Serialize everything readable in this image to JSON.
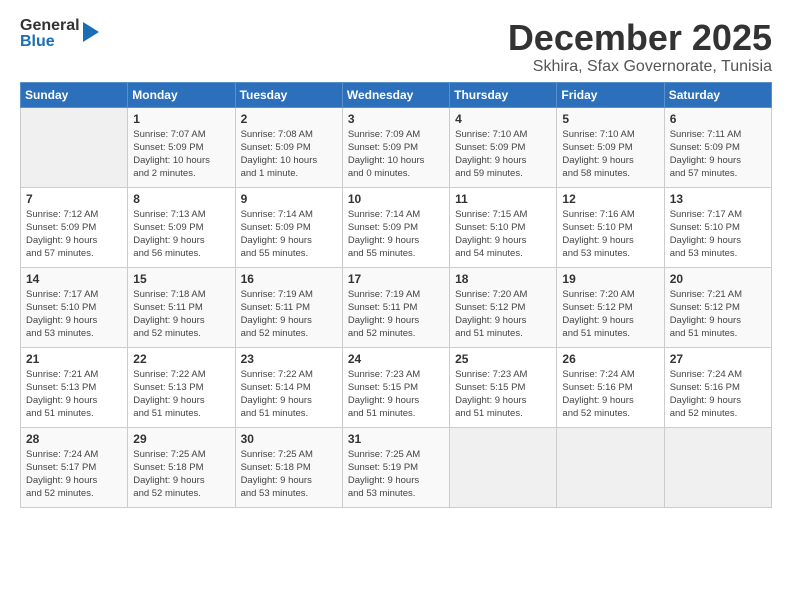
{
  "header": {
    "logo": {
      "general": "General",
      "blue": "Blue"
    },
    "title": "December 2025",
    "location": "Skhira, Sfax Governorate, Tunisia"
  },
  "days_of_week": [
    "Sunday",
    "Monday",
    "Tuesday",
    "Wednesday",
    "Thursday",
    "Friday",
    "Saturday"
  ],
  "weeks": [
    [
      {
        "day": "",
        "info": ""
      },
      {
        "day": "1",
        "info": "Sunrise: 7:07 AM\nSunset: 5:09 PM\nDaylight: 10 hours\nand 2 minutes."
      },
      {
        "day": "2",
        "info": "Sunrise: 7:08 AM\nSunset: 5:09 PM\nDaylight: 10 hours\nand 1 minute."
      },
      {
        "day": "3",
        "info": "Sunrise: 7:09 AM\nSunset: 5:09 PM\nDaylight: 10 hours\nand 0 minutes."
      },
      {
        "day": "4",
        "info": "Sunrise: 7:10 AM\nSunset: 5:09 PM\nDaylight: 9 hours\nand 59 minutes."
      },
      {
        "day": "5",
        "info": "Sunrise: 7:10 AM\nSunset: 5:09 PM\nDaylight: 9 hours\nand 58 minutes."
      },
      {
        "day": "6",
        "info": "Sunrise: 7:11 AM\nSunset: 5:09 PM\nDaylight: 9 hours\nand 57 minutes."
      }
    ],
    [
      {
        "day": "7",
        "info": "Sunrise: 7:12 AM\nSunset: 5:09 PM\nDaylight: 9 hours\nand 57 minutes."
      },
      {
        "day": "8",
        "info": "Sunrise: 7:13 AM\nSunset: 5:09 PM\nDaylight: 9 hours\nand 56 minutes."
      },
      {
        "day": "9",
        "info": "Sunrise: 7:14 AM\nSunset: 5:09 PM\nDaylight: 9 hours\nand 55 minutes."
      },
      {
        "day": "10",
        "info": "Sunrise: 7:14 AM\nSunset: 5:09 PM\nDaylight: 9 hours\nand 55 minutes."
      },
      {
        "day": "11",
        "info": "Sunrise: 7:15 AM\nSunset: 5:10 PM\nDaylight: 9 hours\nand 54 minutes."
      },
      {
        "day": "12",
        "info": "Sunrise: 7:16 AM\nSunset: 5:10 PM\nDaylight: 9 hours\nand 53 minutes."
      },
      {
        "day": "13",
        "info": "Sunrise: 7:17 AM\nSunset: 5:10 PM\nDaylight: 9 hours\nand 53 minutes."
      }
    ],
    [
      {
        "day": "14",
        "info": "Sunrise: 7:17 AM\nSunset: 5:10 PM\nDaylight: 9 hours\nand 53 minutes."
      },
      {
        "day": "15",
        "info": "Sunrise: 7:18 AM\nSunset: 5:11 PM\nDaylight: 9 hours\nand 52 minutes."
      },
      {
        "day": "16",
        "info": "Sunrise: 7:19 AM\nSunset: 5:11 PM\nDaylight: 9 hours\nand 52 minutes."
      },
      {
        "day": "17",
        "info": "Sunrise: 7:19 AM\nSunset: 5:11 PM\nDaylight: 9 hours\nand 52 minutes."
      },
      {
        "day": "18",
        "info": "Sunrise: 7:20 AM\nSunset: 5:12 PM\nDaylight: 9 hours\nand 51 minutes."
      },
      {
        "day": "19",
        "info": "Sunrise: 7:20 AM\nSunset: 5:12 PM\nDaylight: 9 hours\nand 51 minutes."
      },
      {
        "day": "20",
        "info": "Sunrise: 7:21 AM\nSunset: 5:12 PM\nDaylight: 9 hours\nand 51 minutes."
      }
    ],
    [
      {
        "day": "21",
        "info": "Sunrise: 7:21 AM\nSunset: 5:13 PM\nDaylight: 9 hours\nand 51 minutes."
      },
      {
        "day": "22",
        "info": "Sunrise: 7:22 AM\nSunset: 5:13 PM\nDaylight: 9 hours\nand 51 minutes."
      },
      {
        "day": "23",
        "info": "Sunrise: 7:22 AM\nSunset: 5:14 PM\nDaylight: 9 hours\nand 51 minutes."
      },
      {
        "day": "24",
        "info": "Sunrise: 7:23 AM\nSunset: 5:15 PM\nDaylight: 9 hours\nand 51 minutes."
      },
      {
        "day": "25",
        "info": "Sunrise: 7:23 AM\nSunset: 5:15 PM\nDaylight: 9 hours\nand 51 minutes."
      },
      {
        "day": "26",
        "info": "Sunrise: 7:24 AM\nSunset: 5:16 PM\nDaylight: 9 hours\nand 52 minutes."
      },
      {
        "day": "27",
        "info": "Sunrise: 7:24 AM\nSunset: 5:16 PM\nDaylight: 9 hours\nand 52 minutes."
      }
    ],
    [
      {
        "day": "28",
        "info": "Sunrise: 7:24 AM\nSunset: 5:17 PM\nDaylight: 9 hours\nand 52 minutes."
      },
      {
        "day": "29",
        "info": "Sunrise: 7:25 AM\nSunset: 5:18 PM\nDaylight: 9 hours\nand 52 minutes."
      },
      {
        "day": "30",
        "info": "Sunrise: 7:25 AM\nSunset: 5:18 PM\nDaylight: 9 hours\nand 53 minutes."
      },
      {
        "day": "31",
        "info": "Sunrise: 7:25 AM\nSunset: 5:19 PM\nDaylight: 9 hours\nand 53 minutes."
      },
      {
        "day": "",
        "info": ""
      },
      {
        "day": "",
        "info": ""
      },
      {
        "day": "",
        "info": ""
      }
    ]
  ]
}
